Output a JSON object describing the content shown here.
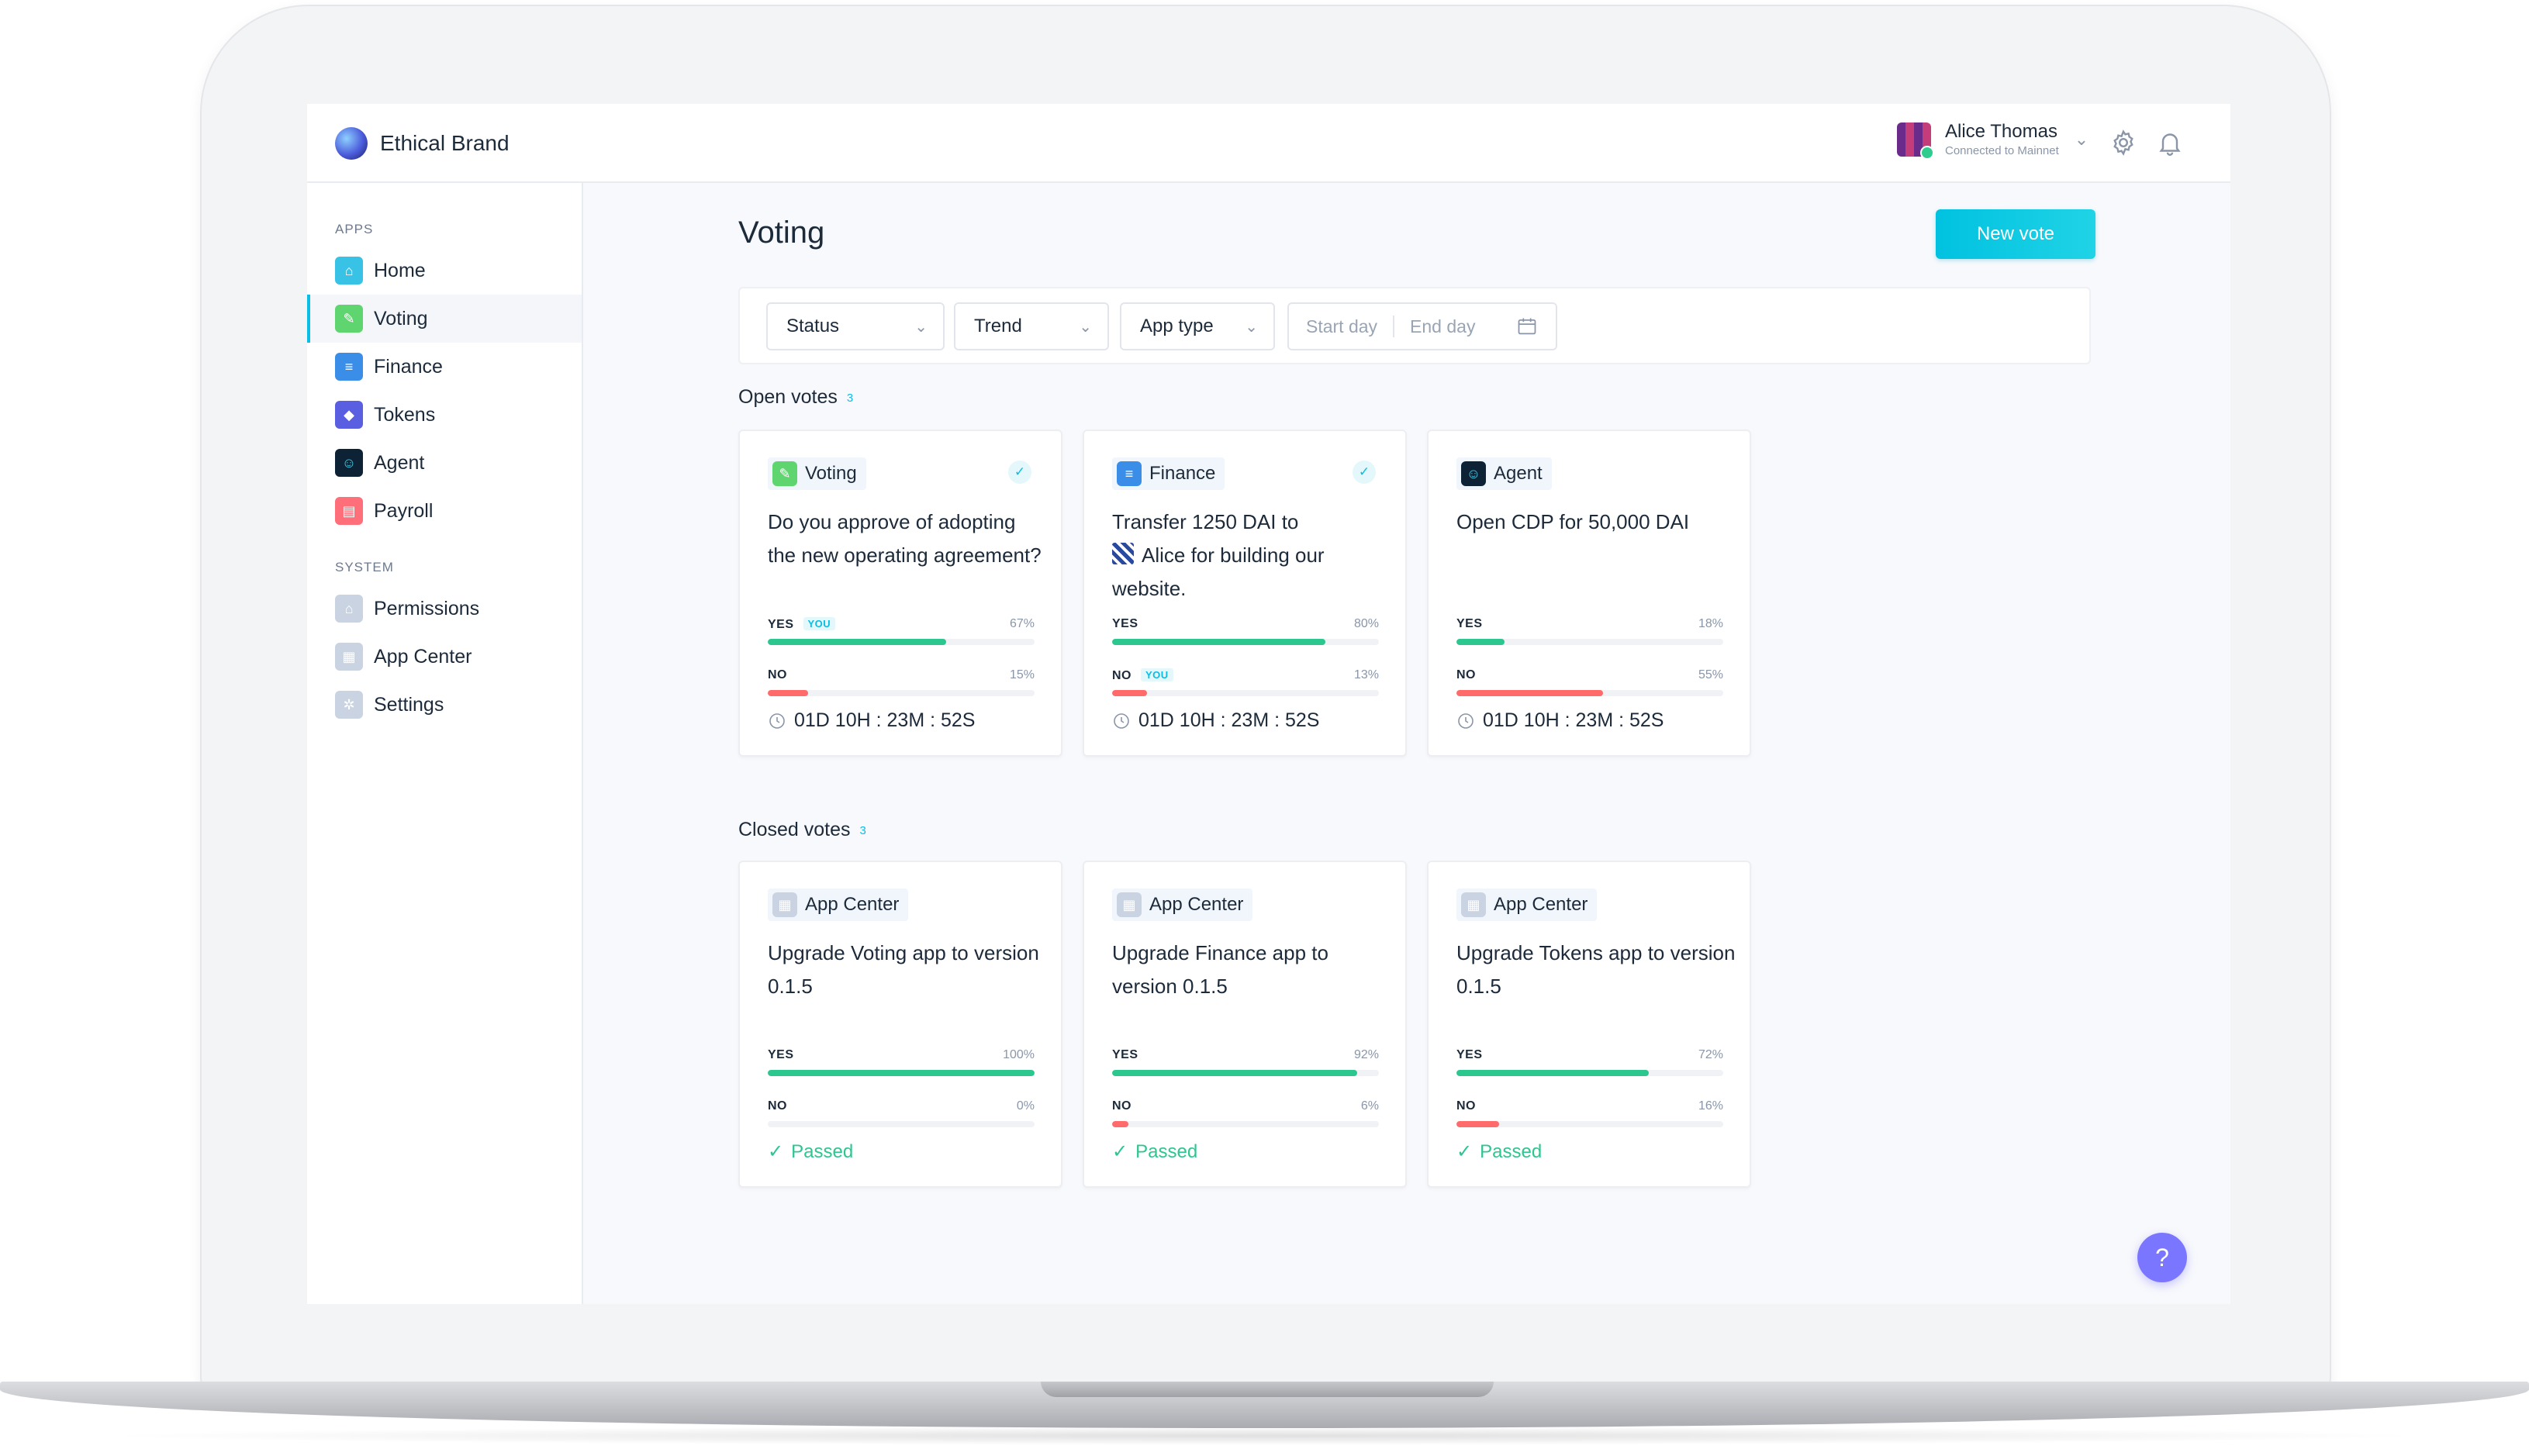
{
  "brand": {
    "name": "Ethical Brand"
  },
  "user": {
    "name": "Alice Thomas",
    "status": "Connected to Mainnet"
  },
  "sidebar": {
    "apps_heading": "APPS",
    "system_heading": "SYSTEM",
    "apps": [
      {
        "label": "Home",
        "icon": "home-icon",
        "color": "#38c3e6"
      },
      {
        "label": "Voting",
        "icon": "voting-icon",
        "color": "#5fd56f"
      },
      {
        "label": "Finance",
        "icon": "finance-icon",
        "color": "#3b8ee8"
      },
      {
        "label": "Tokens",
        "icon": "tokens-icon",
        "color": "#5a5ee0"
      },
      {
        "label": "Agent",
        "icon": "agent-icon",
        "color": "#0e2236"
      },
      {
        "label": "Payroll",
        "icon": "payroll-icon",
        "color": "#ff6f7a"
      }
    ],
    "system": [
      {
        "label": "Permissions",
        "icon": "permissions-icon"
      },
      {
        "label": "App Center",
        "icon": "app-center-icon"
      },
      {
        "label": "Settings",
        "icon": "settings-icon"
      }
    ],
    "active": "Voting"
  },
  "page": {
    "title": "Voting",
    "new_vote_label": "New vote"
  },
  "filters": {
    "status": "Status",
    "trend": "Trend",
    "app_type": "App type",
    "start_day": "Start day",
    "end_day": "End day"
  },
  "open_votes": {
    "title": "Open votes",
    "count": "3",
    "cards": [
      {
        "app": "Voting",
        "q": "Do you approve of adopting the new operating agreement?",
        "yes_pct": "67%",
        "yes": 67,
        "no_pct": "15%",
        "no": 15,
        "timer": "01D  10H : 23M : 52S"
      },
      {
        "app": "Finance",
        "q_before": "Transfer 1250 DAI to",
        "q_user": "Alice",
        "q_after": " for building our website.",
        "yes_pct": "80%",
        "yes": 80,
        "no_pct": "13%",
        "no": 13,
        "timer": "01D  10H : 23M : 52S"
      },
      {
        "app": "Agent",
        "q": "Open CDP for 50,000 DAI",
        "yes_pct": "18%",
        "yes": 18,
        "no_pct": "55%",
        "no": 55,
        "timer": "01D  10H : 23M : 52S"
      }
    ]
  },
  "closed_votes": {
    "title": "Closed votes",
    "count": "3",
    "cards": [
      {
        "app": "App Center",
        "q": "Upgrade Voting app to version 0.1.5",
        "yes_pct": "100%",
        "yes": 100,
        "no_pct": "0%",
        "no": 0,
        "status": "Passed"
      },
      {
        "app": "App Center",
        "q": "Upgrade Finance app to version 0.1.5",
        "yes_pct": "92%",
        "yes": 92,
        "no_pct": "6%",
        "no": 6,
        "status": "Passed"
      },
      {
        "app": "App Center",
        "q": "Upgrade Tokens app to version 0.1.5",
        "yes_pct": "72%",
        "yes": 72,
        "no_pct": "16%",
        "no": 16,
        "status": "Passed"
      }
    ]
  },
  "labels": {
    "yes": "YES",
    "no": "NO",
    "you": "YOU"
  },
  "help": "?"
}
